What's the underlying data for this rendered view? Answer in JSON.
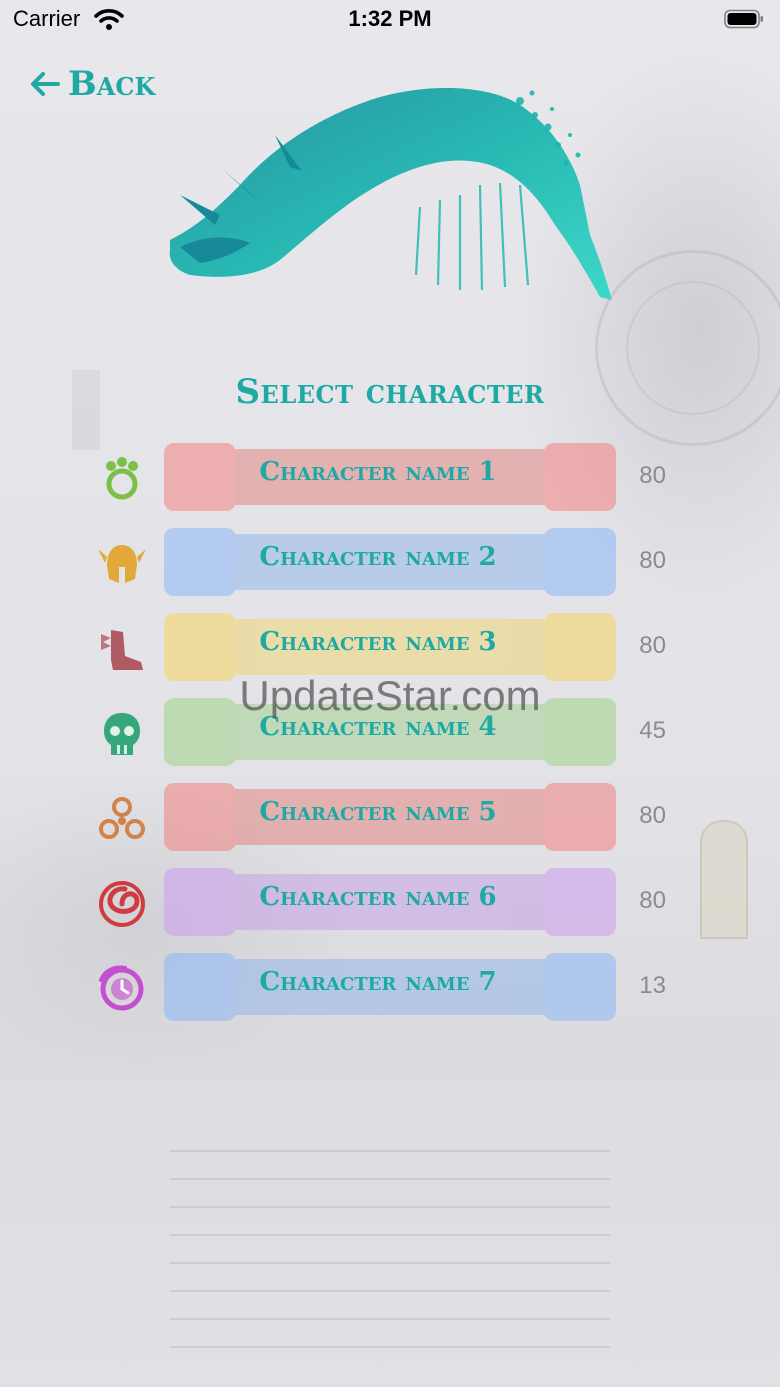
{
  "status_bar": {
    "carrier": "Carrier",
    "time": "1:32 PM"
  },
  "nav": {
    "back_label": "Back"
  },
  "title": "Select character",
  "characters": [
    {
      "name": "Character name 1",
      "level": "80",
      "icon": "ranger-paw-icon",
      "banner": "#e37d7a",
      "color": "#7cc04a"
    },
    {
      "name": "Character name 2",
      "level": "80",
      "icon": "guardian-helmet-icon",
      "banner": "#8bb3ec",
      "color": "#e2a93a"
    },
    {
      "name": "Character name 3",
      "level": "80",
      "icon": "thief-boot-icon",
      "banner": "#f1d569",
      "color": "#b05a63"
    },
    {
      "name": "Character name 4",
      "level": "45",
      "icon": "necromancer-skull-icon",
      "banner": "#9fd08a",
      "color": "#35a77a"
    },
    {
      "name": "Character name 5",
      "level": "80",
      "icon": "engineer-gear-icon",
      "banner": "#e37d7a",
      "color": "#d0834a"
    },
    {
      "name": "Character name 6",
      "level": "80",
      "icon": "elementalist-swirl-icon",
      "banner": "#c59be6",
      "color": "#cf3b40"
    },
    {
      "name": "Character name 7",
      "level": "13",
      "icon": "mesmer-clock-icon",
      "banner": "#8bb3ec",
      "color": "#c54fd0"
    }
  ],
  "watermark": "UpdateStar.com",
  "colors": {
    "accent": "#1fa9a4",
    "level_text": "#8b8b8f"
  }
}
